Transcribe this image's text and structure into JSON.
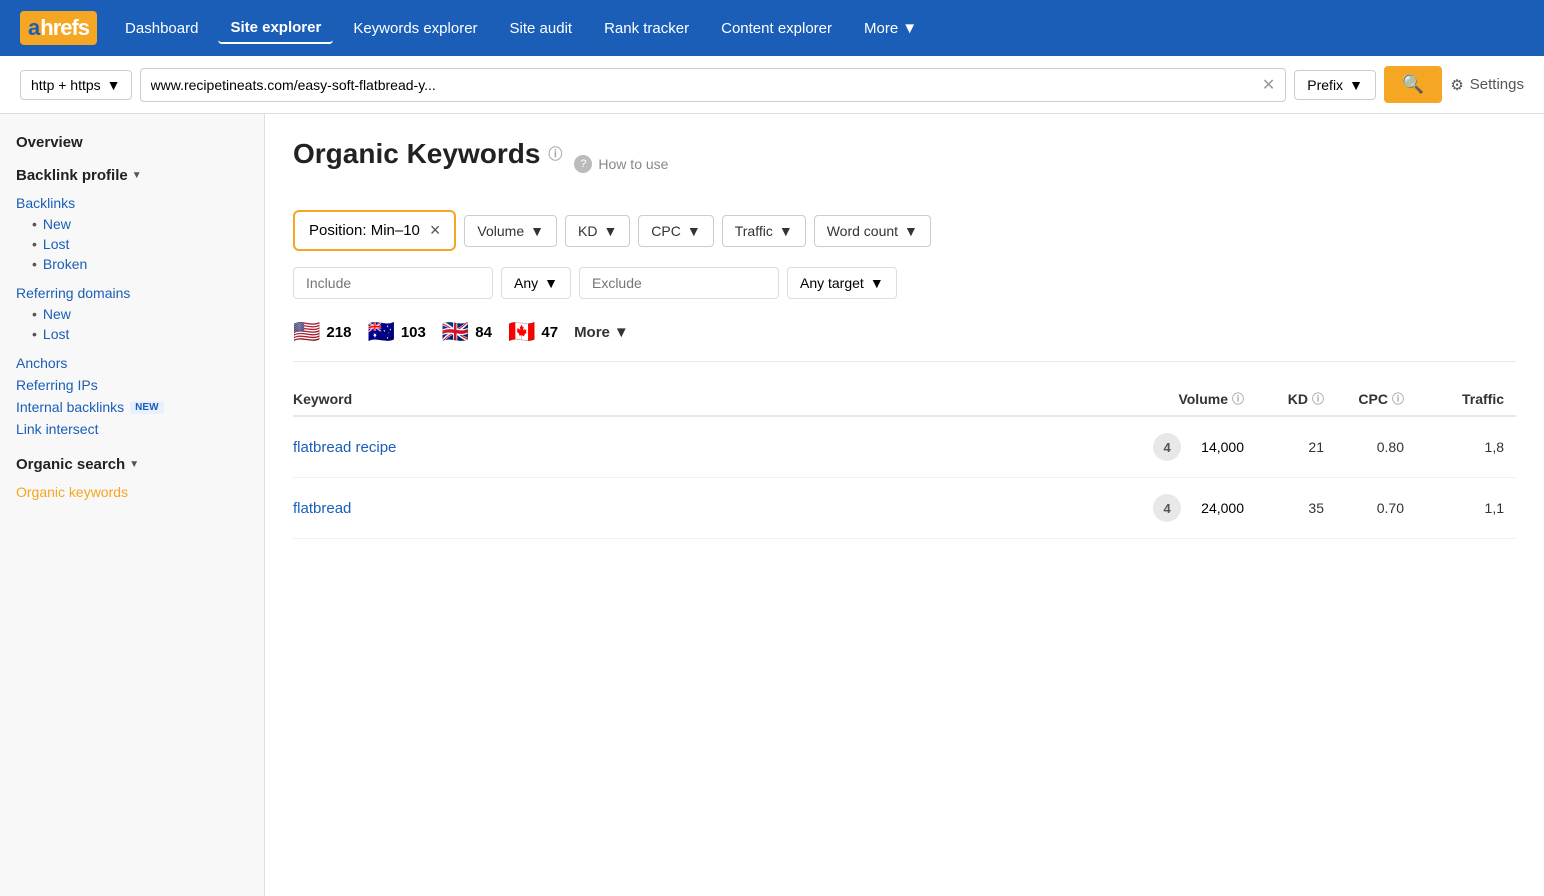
{
  "logo": {
    "a": "a",
    "hrefs": "hrefs"
  },
  "nav": {
    "links": [
      {
        "label": "Dashboard",
        "active": false
      },
      {
        "label": "Site explorer",
        "active": true
      },
      {
        "label": "Keywords explorer",
        "active": false
      },
      {
        "label": "Site audit",
        "active": false
      },
      {
        "label": "Rank tracker",
        "active": false
      },
      {
        "label": "Content explorer",
        "active": false
      },
      {
        "label": "More",
        "active": false
      }
    ]
  },
  "searchbar": {
    "protocol": "http + https",
    "url": "www.recipetineats.com/easy-soft-flatbread-y...",
    "mode": "Prefix",
    "settings_label": "Settings"
  },
  "sidebar": {
    "overview": "Overview",
    "backlink_profile": "Backlink profile",
    "backlinks": "Backlinks",
    "backlinks_new": "New",
    "backlinks_lost": "Lost",
    "backlinks_broken": "Broken",
    "referring_domains": "Referring domains",
    "referring_domains_new": "New",
    "referring_domains_lost": "Lost",
    "anchors": "Anchors",
    "referring_ips": "Referring IPs",
    "internal_backlinks": "Internal backlinks",
    "internal_backlinks_badge": "NEW",
    "link_intersect": "Link intersect",
    "organic_search": "Organic search",
    "organic_keywords": "Organic keywords"
  },
  "content": {
    "page_title": "Organic Keywords",
    "how_to_use": "How to use"
  },
  "filters": {
    "position_label": "Position: Min–10",
    "position_x": "×",
    "volume_label": "Volume",
    "kd_label": "KD",
    "cpc_label": "CPC",
    "traffic_label": "Traffic",
    "word_count_label": "Word count",
    "include_placeholder": "Include",
    "any_label": "Any",
    "exclude_placeholder": "Exclude",
    "any_target_label": "Any target"
  },
  "countries": [
    {
      "flag": "🇺🇸",
      "count": "218"
    },
    {
      "flag": "🇦🇺",
      "count": "103"
    },
    {
      "flag": "🇬🇧",
      "count": "84"
    },
    {
      "flag": "🇨🇦",
      "count": "47"
    },
    {
      "more_label": "More"
    }
  ],
  "table": {
    "columns": [
      {
        "label": "Keyword",
        "align": "left"
      },
      {
        "label": "Volume",
        "align": "right",
        "info": true
      },
      {
        "label": "KD",
        "align": "right",
        "info": true
      },
      {
        "label": "CPC",
        "align": "right",
        "info": true
      },
      {
        "label": "Traffic",
        "align": "right",
        "info": false
      }
    ],
    "rows": [
      {
        "keyword": "flatbread recipe",
        "position": 4,
        "volume": "14,000",
        "kd": "21",
        "cpc": "0.80",
        "traffic": "1,8"
      },
      {
        "keyword": "flatbread",
        "position": 4,
        "volume": "24,000",
        "kd": "35",
        "cpc": "0.70",
        "traffic": "1,1"
      }
    ]
  },
  "colors": {
    "orange": "#f5a623",
    "blue": "#1a5eb8",
    "nav_bg": "#1a5eb8"
  }
}
